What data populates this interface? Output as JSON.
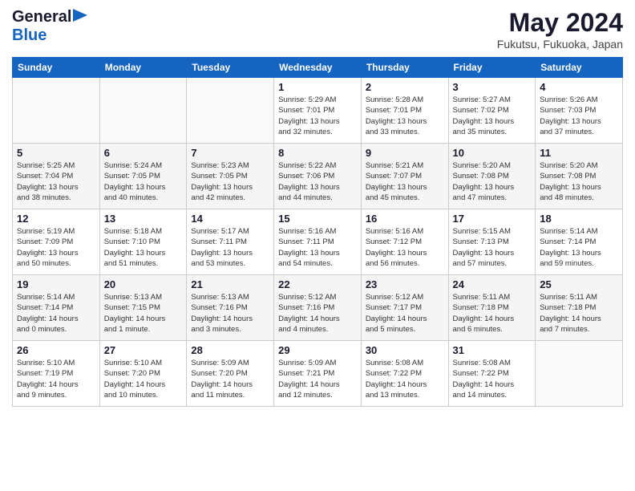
{
  "header": {
    "logo_general": "General",
    "logo_blue": "Blue",
    "month": "May 2024",
    "location": "Fukutsu, Fukuoka, Japan"
  },
  "days_of_week": [
    "Sunday",
    "Monday",
    "Tuesday",
    "Wednesday",
    "Thursday",
    "Friday",
    "Saturday"
  ],
  "weeks": [
    [
      {
        "day": "",
        "info": ""
      },
      {
        "day": "",
        "info": ""
      },
      {
        "day": "",
        "info": ""
      },
      {
        "day": "1",
        "info": "Sunrise: 5:29 AM\nSunset: 7:01 PM\nDaylight: 13 hours\nand 32 minutes."
      },
      {
        "day": "2",
        "info": "Sunrise: 5:28 AM\nSunset: 7:01 PM\nDaylight: 13 hours\nand 33 minutes."
      },
      {
        "day": "3",
        "info": "Sunrise: 5:27 AM\nSunset: 7:02 PM\nDaylight: 13 hours\nand 35 minutes."
      },
      {
        "day": "4",
        "info": "Sunrise: 5:26 AM\nSunset: 7:03 PM\nDaylight: 13 hours\nand 37 minutes."
      }
    ],
    [
      {
        "day": "5",
        "info": "Sunrise: 5:25 AM\nSunset: 7:04 PM\nDaylight: 13 hours\nand 38 minutes."
      },
      {
        "day": "6",
        "info": "Sunrise: 5:24 AM\nSunset: 7:05 PM\nDaylight: 13 hours\nand 40 minutes."
      },
      {
        "day": "7",
        "info": "Sunrise: 5:23 AM\nSunset: 7:05 PM\nDaylight: 13 hours\nand 42 minutes."
      },
      {
        "day": "8",
        "info": "Sunrise: 5:22 AM\nSunset: 7:06 PM\nDaylight: 13 hours\nand 44 minutes."
      },
      {
        "day": "9",
        "info": "Sunrise: 5:21 AM\nSunset: 7:07 PM\nDaylight: 13 hours\nand 45 minutes."
      },
      {
        "day": "10",
        "info": "Sunrise: 5:20 AM\nSunset: 7:08 PM\nDaylight: 13 hours\nand 47 minutes."
      },
      {
        "day": "11",
        "info": "Sunrise: 5:20 AM\nSunset: 7:08 PM\nDaylight: 13 hours\nand 48 minutes."
      }
    ],
    [
      {
        "day": "12",
        "info": "Sunrise: 5:19 AM\nSunset: 7:09 PM\nDaylight: 13 hours\nand 50 minutes."
      },
      {
        "day": "13",
        "info": "Sunrise: 5:18 AM\nSunset: 7:10 PM\nDaylight: 13 hours\nand 51 minutes."
      },
      {
        "day": "14",
        "info": "Sunrise: 5:17 AM\nSunset: 7:11 PM\nDaylight: 13 hours\nand 53 minutes."
      },
      {
        "day": "15",
        "info": "Sunrise: 5:16 AM\nSunset: 7:11 PM\nDaylight: 13 hours\nand 54 minutes."
      },
      {
        "day": "16",
        "info": "Sunrise: 5:16 AM\nSunset: 7:12 PM\nDaylight: 13 hours\nand 56 minutes."
      },
      {
        "day": "17",
        "info": "Sunrise: 5:15 AM\nSunset: 7:13 PM\nDaylight: 13 hours\nand 57 minutes."
      },
      {
        "day": "18",
        "info": "Sunrise: 5:14 AM\nSunset: 7:14 PM\nDaylight: 13 hours\nand 59 minutes."
      }
    ],
    [
      {
        "day": "19",
        "info": "Sunrise: 5:14 AM\nSunset: 7:14 PM\nDaylight: 14 hours\nand 0 minutes."
      },
      {
        "day": "20",
        "info": "Sunrise: 5:13 AM\nSunset: 7:15 PM\nDaylight: 14 hours\nand 1 minute."
      },
      {
        "day": "21",
        "info": "Sunrise: 5:13 AM\nSunset: 7:16 PM\nDaylight: 14 hours\nand 3 minutes."
      },
      {
        "day": "22",
        "info": "Sunrise: 5:12 AM\nSunset: 7:16 PM\nDaylight: 14 hours\nand 4 minutes."
      },
      {
        "day": "23",
        "info": "Sunrise: 5:12 AM\nSunset: 7:17 PM\nDaylight: 14 hours\nand 5 minutes."
      },
      {
        "day": "24",
        "info": "Sunrise: 5:11 AM\nSunset: 7:18 PM\nDaylight: 14 hours\nand 6 minutes."
      },
      {
        "day": "25",
        "info": "Sunrise: 5:11 AM\nSunset: 7:18 PM\nDaylight: 14 hours\nand 7 minutes."
      }
    ],
    [
      {
        "day": "26",
        "info": "Sunrise: 5:10 AM\nSunset: 7:19 PM\nDaylight: 14 hours\nand 9 minutes."
      },
      {
        "day": "27",
        "info": "Sunrise: 5:10 AM\nSunset: 7:20 PM\nDaylight: 14 hours\nand 10 minutes."
      },
      {
        "day": "28",
        "info": "Sunrise: 5:09 AM\nSunset: 7:20 PM\nDaylight: 14 hours\nand 11 minutes."
      },
      {
        "day": "29",
        "info": "Sunrise: 5:09 AM\nSunset: 7:21 PM\nDaylight: 14 hours\nand 12 minutes."
      },
      {
        "day": "30",
        "info": "Sunrise: 5:08 AM\nSunset: 7:22 PM\nDaylight: 14 hours\nand 13 minutes."
      },
      {
        "day": "31",
        "info": "Sunrise: 5:08 AM\nSunset: 7:22 PM\nDaylight: 14 hours\nand 14 minutes."
      },
      {
        "day": "",
        "info": ""
      }
    ]
  ]
}
